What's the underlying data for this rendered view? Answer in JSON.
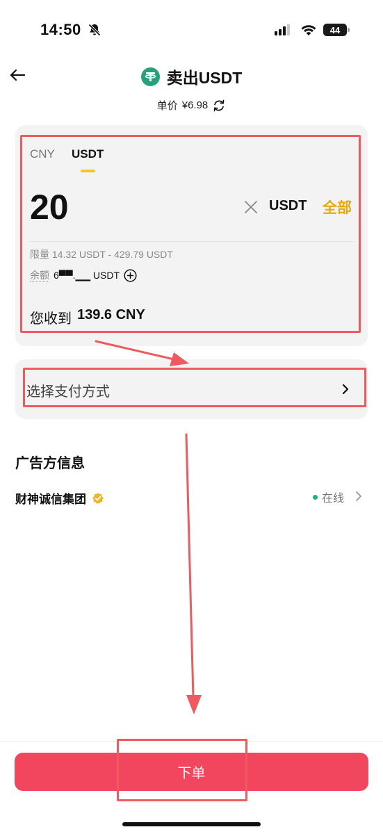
{
  "status_bar": {
    "time": "14:50",
    "battery": "44"
  },
  "header": {
    "title": "卖出USDT",
    "price_label": "单价",
    "price_value": "¥6.98"
  },
  "amount_card": {
    "tabs": [
      {
        "label": "CNY"
      },
      {
        "label": "USDT"
      }
    ],
    "amount": "20",
    "unit": "USDT",
    "all_label": "全部",
    "limit_label": "限量",
    "limit_value": "14.32 USDT - 429.79 USDT",
    "balance_label": "余额",
    "balance_value": "6▀▀.▁▁ USDT",
    "receive_label": "您收到",
    "receive_value": "139.6 CNY"
  },
  "payment": {
    "label": "选择支付方式"
  },
  "advertiser": {
    "section_title": "广告方信息",
    "name": "财神诚信集团",
    "status": "在线"
  },
  "footer": {
    "order_label": "下单"
  },
  "colors": {
    "brand_pink": "#f2465f",
    "accent_yellow": "#f3c623",
    "all_gold": "#e5a90f",
    "tether_green": "#26a17b",
    "online_green": "#20b36f",
    "annotation_red": "#ee5a5e"
  },
  "icons": [
    "bell-slash-icon",
    "signal-icon",
    "wifi-icon",
    "back-arrow-icon",
    "tether-icon",
    "refresh-icon",
    "clear-icon",
    "add-circle-icon",
    "chevron-right-icon",
    "verified-badge-icon"
  ]
}
